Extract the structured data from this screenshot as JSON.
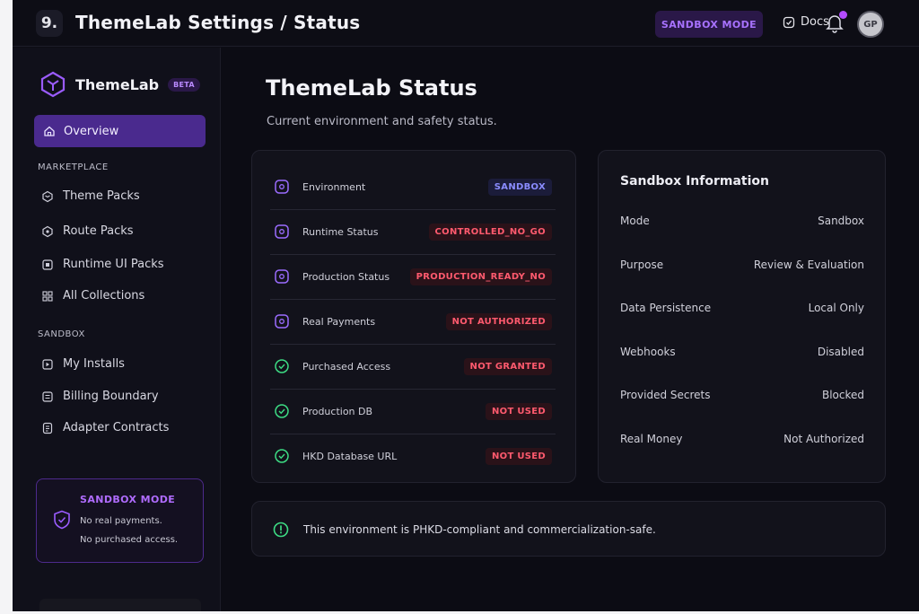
{
  "topbar": {
    "app_icon_glyph": "9.",
    "title": "ThemeLab Settings / Status",
    "mode_badge": "SANDBOX MODE",
    "docs_label": "Docs",
    "avatar_initials": "GP",
    "icons": [
      "app-icon",
      "docs-icon",
      "bell-icon",
      "avatar"
    ]
  },
  "sidebar": {
    "brand": "ThemeLab",
    "badge": "BETA",
    "active_item": "Overview",
    "sections": [
      {
        "label": "MARKETPLACE",
        "items": [
          "Theme Packs",
          "Route Packs",
          "Runtime UI Packs",
          "All Collections"
        ]
      },
      {
        "label": "SANDBOX",
        "items": [
          "My Installs",
          "Billing Boundary",
          "Adapter Contracts"
        ]
      }
    ],
    "sandbox_card": {
      "title": "SANDBOX MODE",
      "lines": [
        "No real payments.",
        "No purchased access."
      ]
    }
  },
  "main": {
    "title": "ThemeLab Status",
    "subtitle": "Current environment and safety status.",
    "status_rows": [
      {
        "label": "Environment",
        "value": "SANDBOX",
        "tone": "blue",
        "icon": "environment-icon"
      },
      {
        "label": "Runtime Status",
        "value": "CONTROLLED_NO_GO",
        "tone": "red",
        "icon": "runtime-icon"
      },
      {
        "label": "Production Status",
        "value": "PRODUCTION_READY_NO",
        "tone": "red",
        "icon": "production-icon"
      },
      {
        "label": "Real Payments",
        "value": "NOT AUTHORIZED",
        "tone": "red",
        "icon": "payments-icon"
      },
      {
        "label": "Purchased Access",
        "value": "NOT GRANTED",
        "tone": "red",
        "icon": "access-icon"
      },
      {
        "label": "Production DB",
        "value": "NOT USED",
        "tone": "red",
        "icon": "database-icon"
      },
      {
        "label": "HKD Database URL",
        "value": "NOT USED",
        "tone": "red",
        "icon": "url-icon"
      }
    ],
    "sandbox_info": {
      "title": "Sandbox Information",
      "rows": [
        {
          "key": "Mode",
          "value": "Sandbox"
        },
        {
          "key": "Purpose",
          "value": "Review & Evaluation"
        },
        {
          "key": "Data Persistence",
          "value": "Local Only"
        },
        {
          "key": "Webhooks",
          "value": "Disabled"
        },
        {
          "key": "Provided Secrets",
          "value": "Blocked"
        },
        {
          "key": "Real Money",
          "value": "Not Authorized"
        }
      ]
    },
    "notice": "This environment is PHKD-compliant and commercialization-safe."
  },
  "colors": {
    "accent": "#7c3aed",
    "accent_text": "#a872ff",
    "danger": "#ff5a6e",
    "info": "#8a8cff",
    "success": "#3ddc84",
    "background": "#0c0c14"
  }
}
